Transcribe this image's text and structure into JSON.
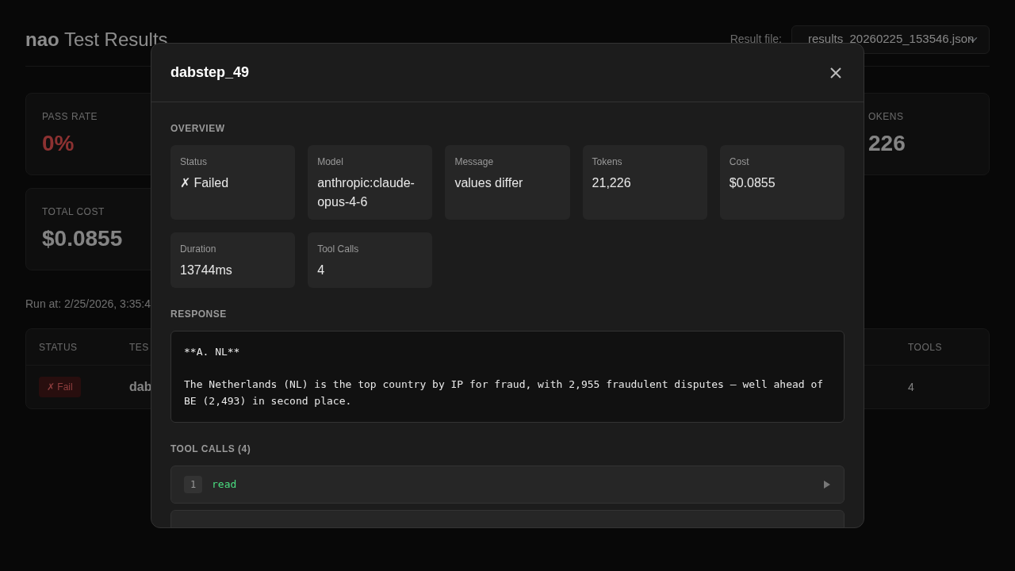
{
  "page": {
    "brand": "nao",
    "title": "Test Results",
    "result_file_label": "Result file:",
    "result_file": "results_20260225_153546.json",
    "stats": [
      {
        "label": "PASS RATE",
        "value": "0%",
        "kind": "danger"
      },
      {
        "label": "OKENS",
        "value": "226",
        "kind": "plain"
      },
      {
        "label": "TOTAL COST",
        "value": "$0.0855",
        "kind": "plain"
      }
    ],
    "run_at": "Run at: 2/25/2026, 3:35:4",
    "table": {
      "columns": [
        "STATUS",
        "TES",
        "TOOLS"
      ],
      "rows": [
        {
          "status": "✗ Fail",
          "passed": false,
          "test": "dab",
          "tools": "4"
        }
      ]
    }
  },
  "modal": {
    "title": "dabstep_49",
    "overview_heading": "OVERVIEW",
    "overview": [
      {
        "label": "Status",
        "value": "✗ Failed"
      },
      {
        "label": "Model",
        "value": "anthropic:claude-opus-4-6"
      },
      {
        "label": "Message",
        "value": "values differ"
      },
      {
        "label": "Tokens",
        "value": "21,226"
      },
      {
        "label": "Cost",
        "value": "$0.0855"
      },
      {
        "label": "Duration",
        "value": "13744ms"
      },
      {
        "label": "Tool Calls",
        "value": "4"
      }
    ],
    "response_heading": "RESPONSE",
    "response": "**A. NL**\n\nThe Netherlands (NL) is the top country by IP for fraud, with 2,955 fraudulent disputes — well ahead of BE (2,493) in second place.",
    "tool_calls_heading": "TOOL CALLS (4)",
    "tool_calls": [
      {
        "kind": "full",
        "index": "1",
        "name": "read",
        "expanded": false
      },
      {
        "kind": "partial"
      }
    ]
  }
}
